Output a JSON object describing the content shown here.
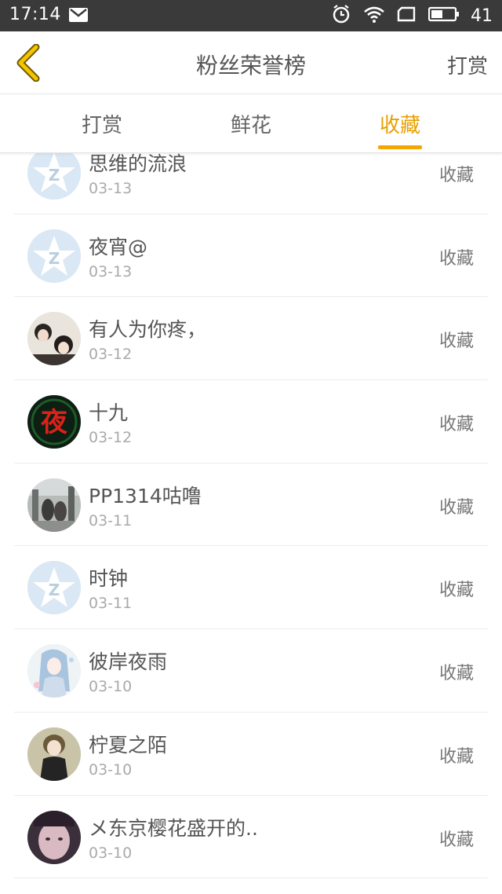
{
  "status_bar": {
    "time": "17:14",
    "battery": "41",
    "icons": [
      "mail-icon",
      "alarm-icon",
      "wifi-icon",
      "screen-icon",
      "battery-icon"
    ]
  },
  "header": {
    "back_icon": "chevron-left-icon",
    "title": "粉丝荣誉榜",
    "action": "打赏"
  },
  "tabs": [
    {
      "label": "打赏",
      "active": false
    },
    {
      "label": "鲜花",
      "active": false
    },
    {
      "label": "收藏",
      "active": true
    }
  ],
  "colors": {
    "accent": "#f2a800",
    "accent_text": "#e8a000",
    "status_bar": "#3a3a3a",
    "default_avatar": "#d9e8f4"
  },
  "list": [
    {
      "name": "思维的流浪",
      "date": "03-13",
      "action": "收藏",
      "avatar": "default"
    },
    {
      "name": "夜宵@",
      "date": "03-13",
      "action": "收藏",
      "avatar": "default"
    },
    {
      "name": "有人为你疼，",
      "date": "03-12",
      "action": "收藏",
      "avatar": "photo-girls"
    },
    {
      "name": "十九",
      "date": "03-12",
      "action": "收藏",
      "avatar": "photo-red-character"
    },
    {
      "name": "PP1314咕噜",
      "date": "03-11",
      "action": "收藏",
      "avatar": "photo-street"
    },
    {
      "name": "时钟",
      "date": "03-11",
      "action": "收藏",
      "avatar": "default"
    },
    {
      "name": "彼岸夜雨",
      "date": "03-10",
      "action": "收藏",
      "avatar": "photo-anime-blue"
    },
    {
      "name": "柠夏之陌",
      "date": "03-10",
      "action": "收藏",
      "avatar": "photo-girl-dark"
    },
    {
      "name": "メ东京樱花盛开的..",
      "date": "03-10",
      "action": "收藏",
      "avatar": "photo-face"
    }
  ]
}
